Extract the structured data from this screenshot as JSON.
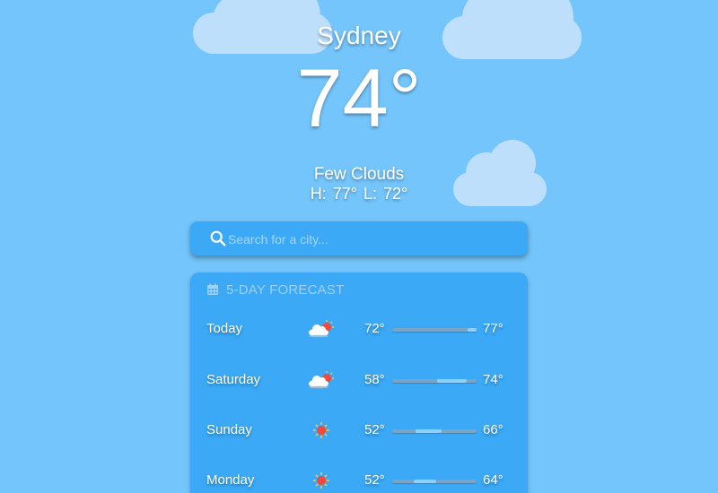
{
  "location": {
    "city": "Sydney",
    "temperature": "74°",
    "condition": "Few Clouds",
    "hi_lo": "H: 77°  L: 72°"
  },
  "search": {
    "placeholder": "Search for a city..."
  },
  "forecast": {
    "title": "5-DAY FORECAST",
    "range_min": 52,
    "range_max": 77,
    "days": [
      {
        "day": "Today",
        "icon": "cloud-sun-icon",
        "low": "72°",
        "high": "77°",
        "low_val": 72,
        "high_val": 77
      },
      {
        "day": "Saturday",
        "icon": "cloud-sun-icon",
        "low": "58°",
        "high": "74°",
        "low_val": 58,
        "high_val": 74
      },
      {
        "day": "Sunday",
        "icon": "sun-icon",
        "low": "52°",
        "high": "66°",
        "low_val": 52,
        "high_val": 66
      },
      {
        "day": "Monday",
        "icon": "sun-icon",
        "low": "52°",
        "high": "64°",
        "low_val": 52,
        "high_val": 64
      }
    ]
  },
  "colors": {
    "background": "#74c5fb",
    "panel": "#3ba9f6",
    "cloud": "#c2e1fd",
    "bar_track": "#7aa3c4",
    "bar_fill": "#8fd0fb"
  }
}
